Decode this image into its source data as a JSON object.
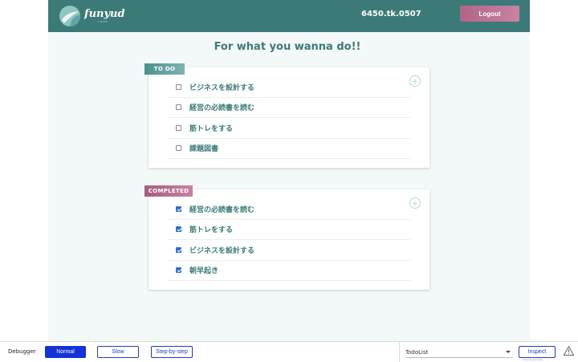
{
  "header": {
    "logo_text": "funyud",
    "logo_sub": "TODO",
    "username": "6450.tk.0507",
    "logout_label": "Logout"
  },
  "main": {
    "title": "For what you wanna do!!",
    "todo": {
      "tag": "TO DO",
      "items": [
        {
          "label": "ビジネスを設計する",
          "checked": false
        },
        {
          "label": "経営の必読書を読む",
          "checked": false
        },
        {
          "label": "筋トレをする",
          "checked": false
        },
        {
          "label": "課題図書",
          "checked": false
        }
      ]
    },
    "completed": {
      "tag": "COMPLETED",
      "items": [
        {
          "label": "経営の必読書を読む",
          "checked": true
        },
        {
          "label": "筋トレをする",
          "checked": true
        },
        {
          "label": "ビジネスを設計する",
          "checked": true
        },
        {
          "label": "朝早起き",
          "checked": true
        }
      ]
    }
  },
  "debugger": {
    "label": "Debugger",
    "normal_label": "Normal",
    "slow_label": "Slow",
    "step_label": "Step-by-step",
    "select_value": "TodoList",
    "inspect_label": "Inspect",
    "inspect_hint": "Show Hyperview"
  },
  "colors": {
    "header": "#3c7a78",
    "accent_pink": "#b16587",
    "debugger_blue": "#1432d8"
  }
}
